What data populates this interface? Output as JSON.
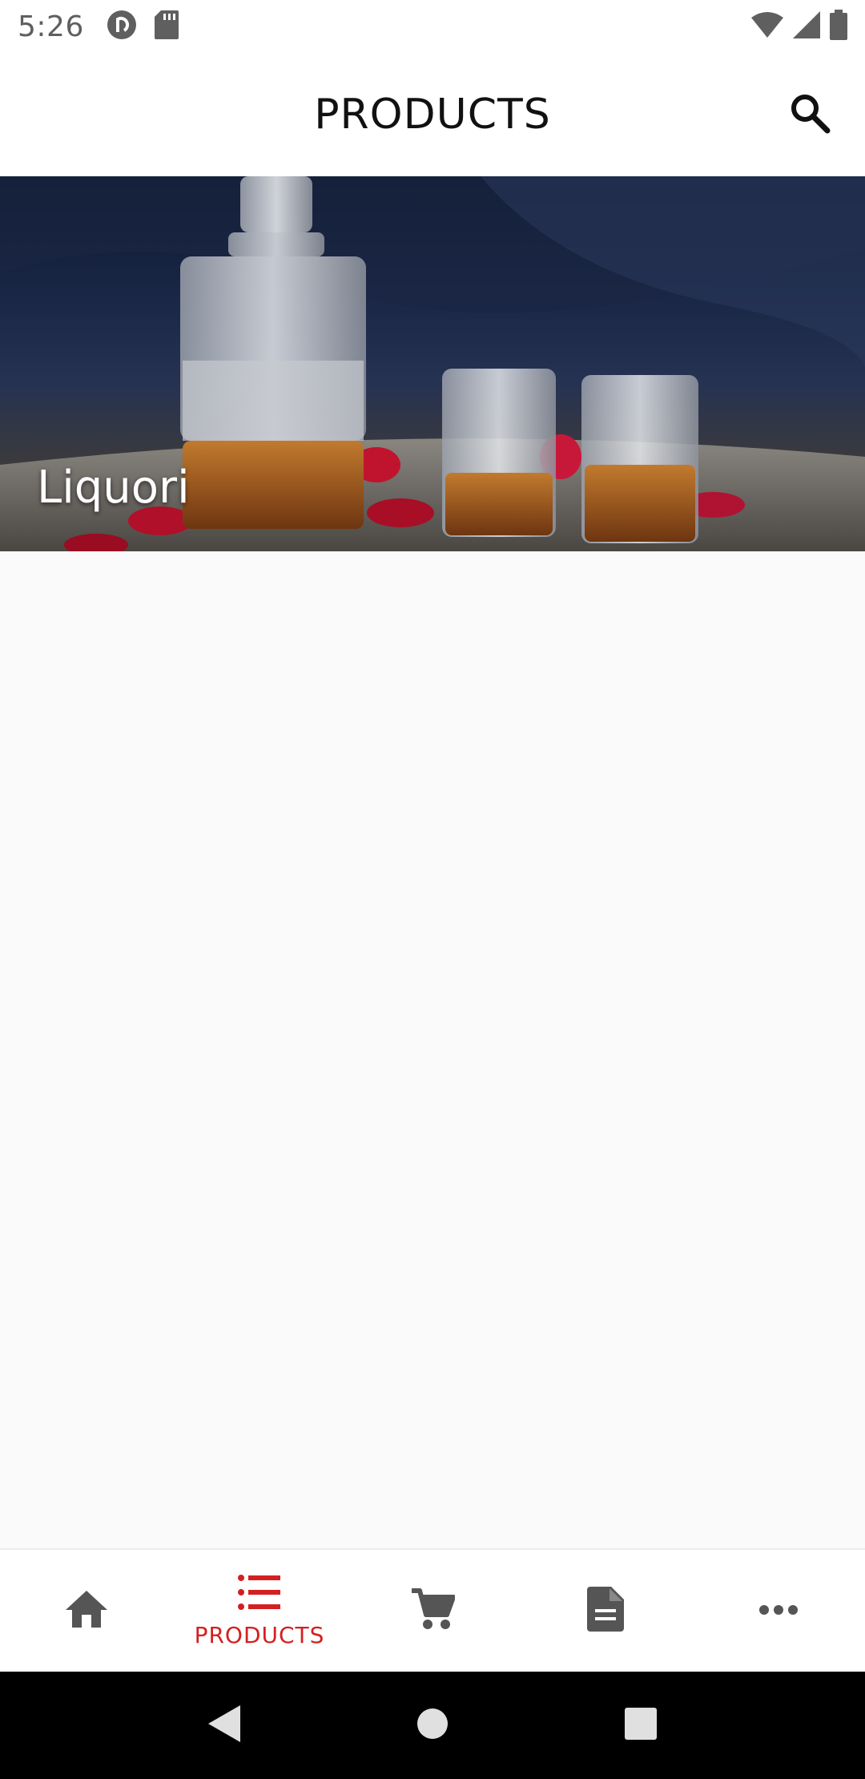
{
  "status_bar": {
    "time": "5:26",
    "left_icons": [
      "pocket-casts-icon",
      "sd-card-icon"
    ],
    "right_icons": [
      "wifi-icon",
      "cellular-signal-icon",
      "battery-icon"
    ]
  },
  "app_bar": {
    "title": "PRODUCTS",
    "search_icon": "search-icon"
  },
  "categories": [
    {
      "label": "Liquori",
      "image": "decanter-and-glasses-photo"
    }
  ],
  "bottom_nav": {
    "items": [
      {
        "icon": "home-icon",
        "label": ""
      },
      {
        "icon": "list-icon",
        "label": "PRODUCTS",
        "active": true
      },
      {
        "icon": "cart-icon",
        "label": ""
      },
      {
        "icon": "document-icon",
        "label": ""
      },
      {
        "icon": "more-icon",
        "label": ""
      }
    ],
    "active_color": "#d32020",
    "inactive_color": "#555555"
  },
  "system_nav": {
    "icons": [
      "back-icon",
      "home-circle-icon",
      "recents-icon"
    ]
  }
}
